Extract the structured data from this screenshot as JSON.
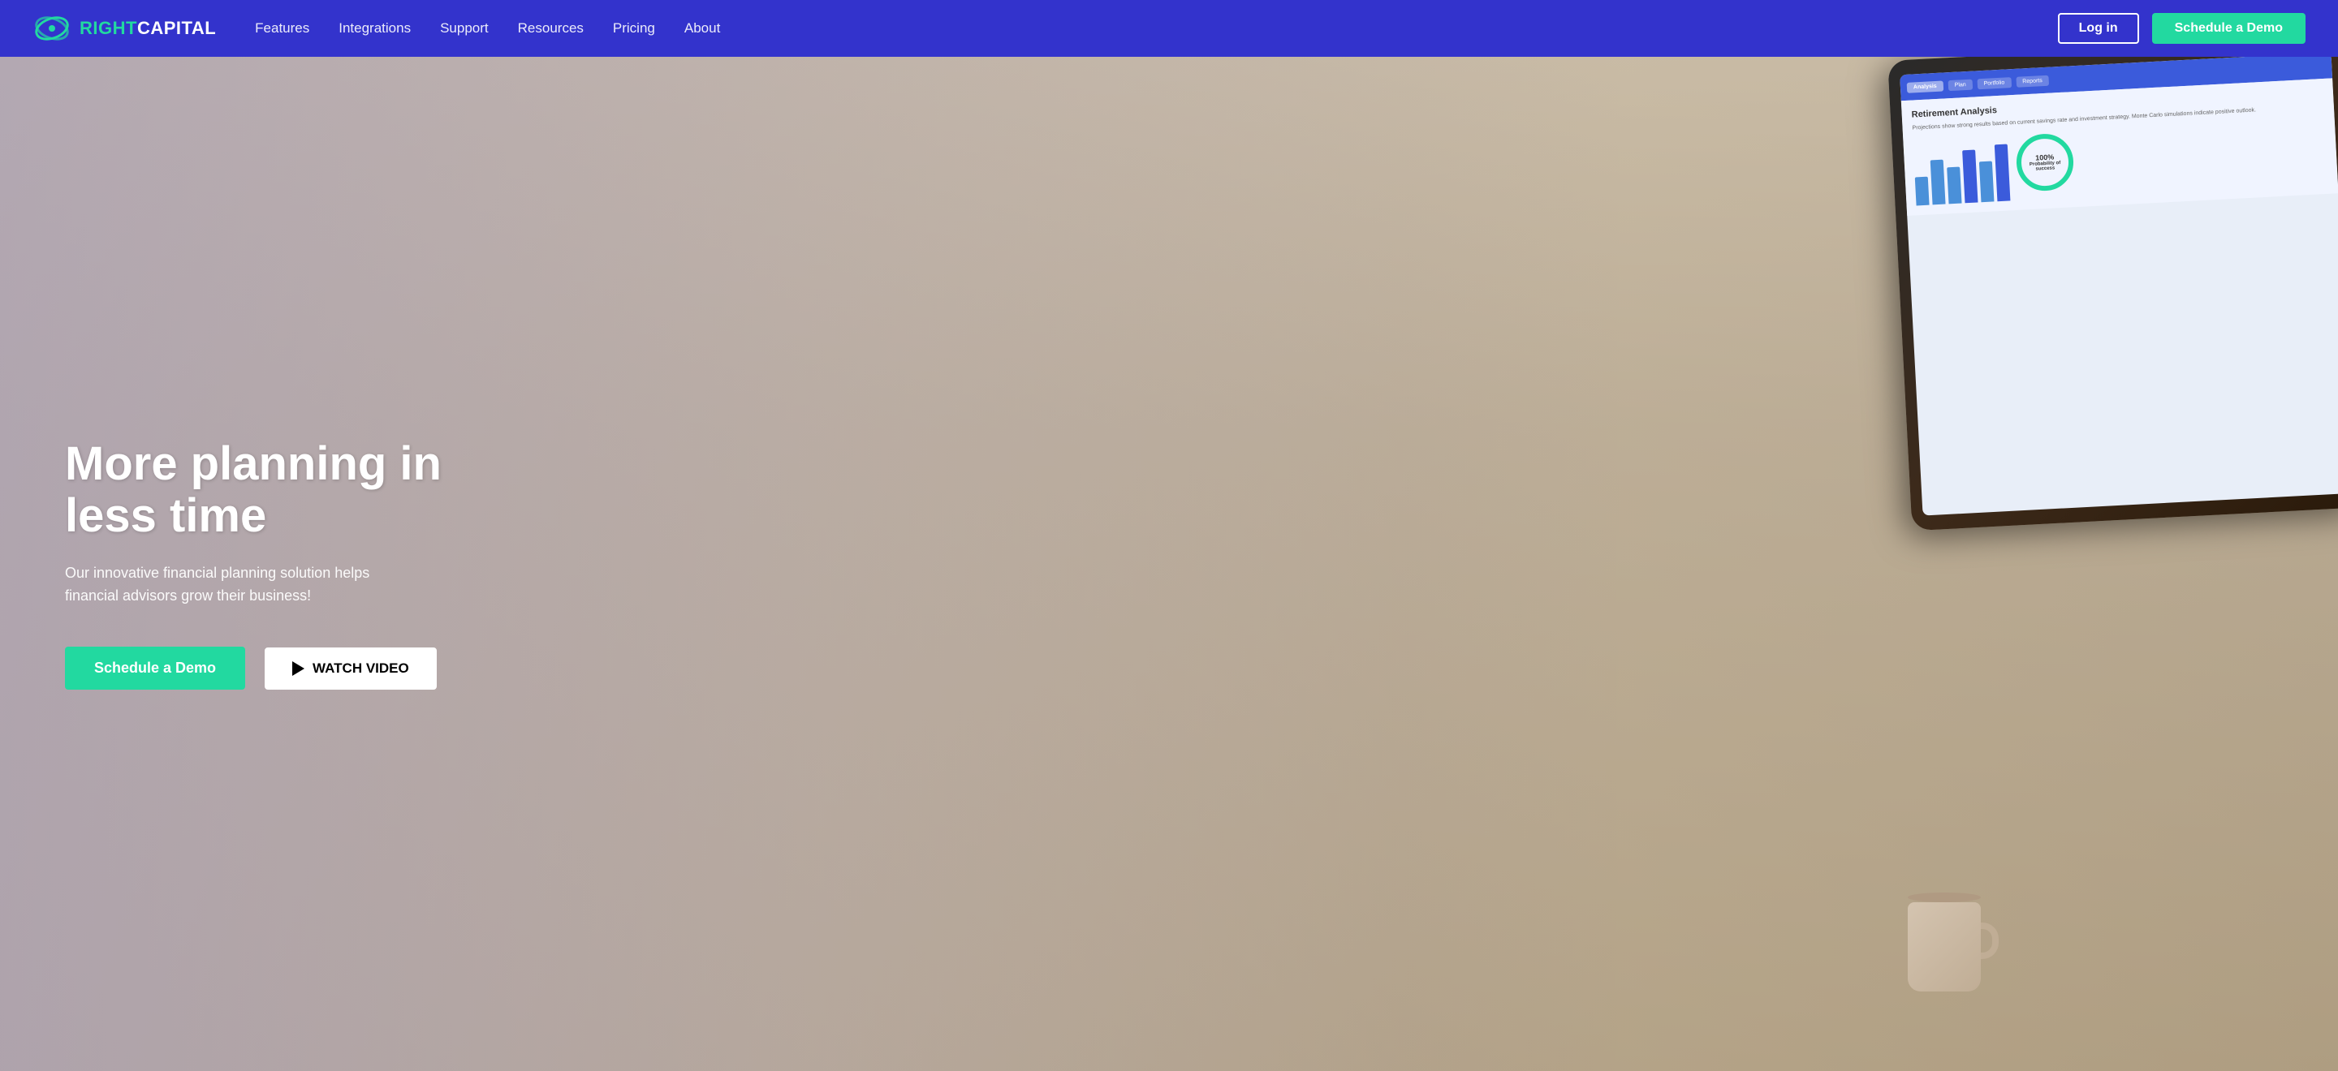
{
  "navbar": {
    "logo_right": "RIGHT",
    "logo_capital": "CAPITAL",
    "links": [
      {
        "label": "Features",
        "id": "features"
      },
      {
        "label": "Integrations",
        "id": "integrations"
      },
      {
        "label": "Support",
        "id": "support"
      },
      {
        "label": "Resources",
        "id": "resources"
      },
      {
        "label": "Pricing",
        "id": "pricing"
      },
      {
        "label": "About",
        "id": "about"
      }
    ],
    "login_label": "Log in",
    "demo_label": "Schedule a Demo"
  },
  "hero": {
    "headline": "More planning in less time",
    "subtext_line1": "Our innovative financial planning solution helps",
    "subtext_line2": "financial advisors grow their business!",
    "btn_schedule": "Schedule a Demo",
    "btn_watch": "WATCH VIDEO",
    "tablet_title": "Retirement Analysis",
    "tablet_percent": "100%",
    "tablet_sublabel": "Probability of success"
  }
}
